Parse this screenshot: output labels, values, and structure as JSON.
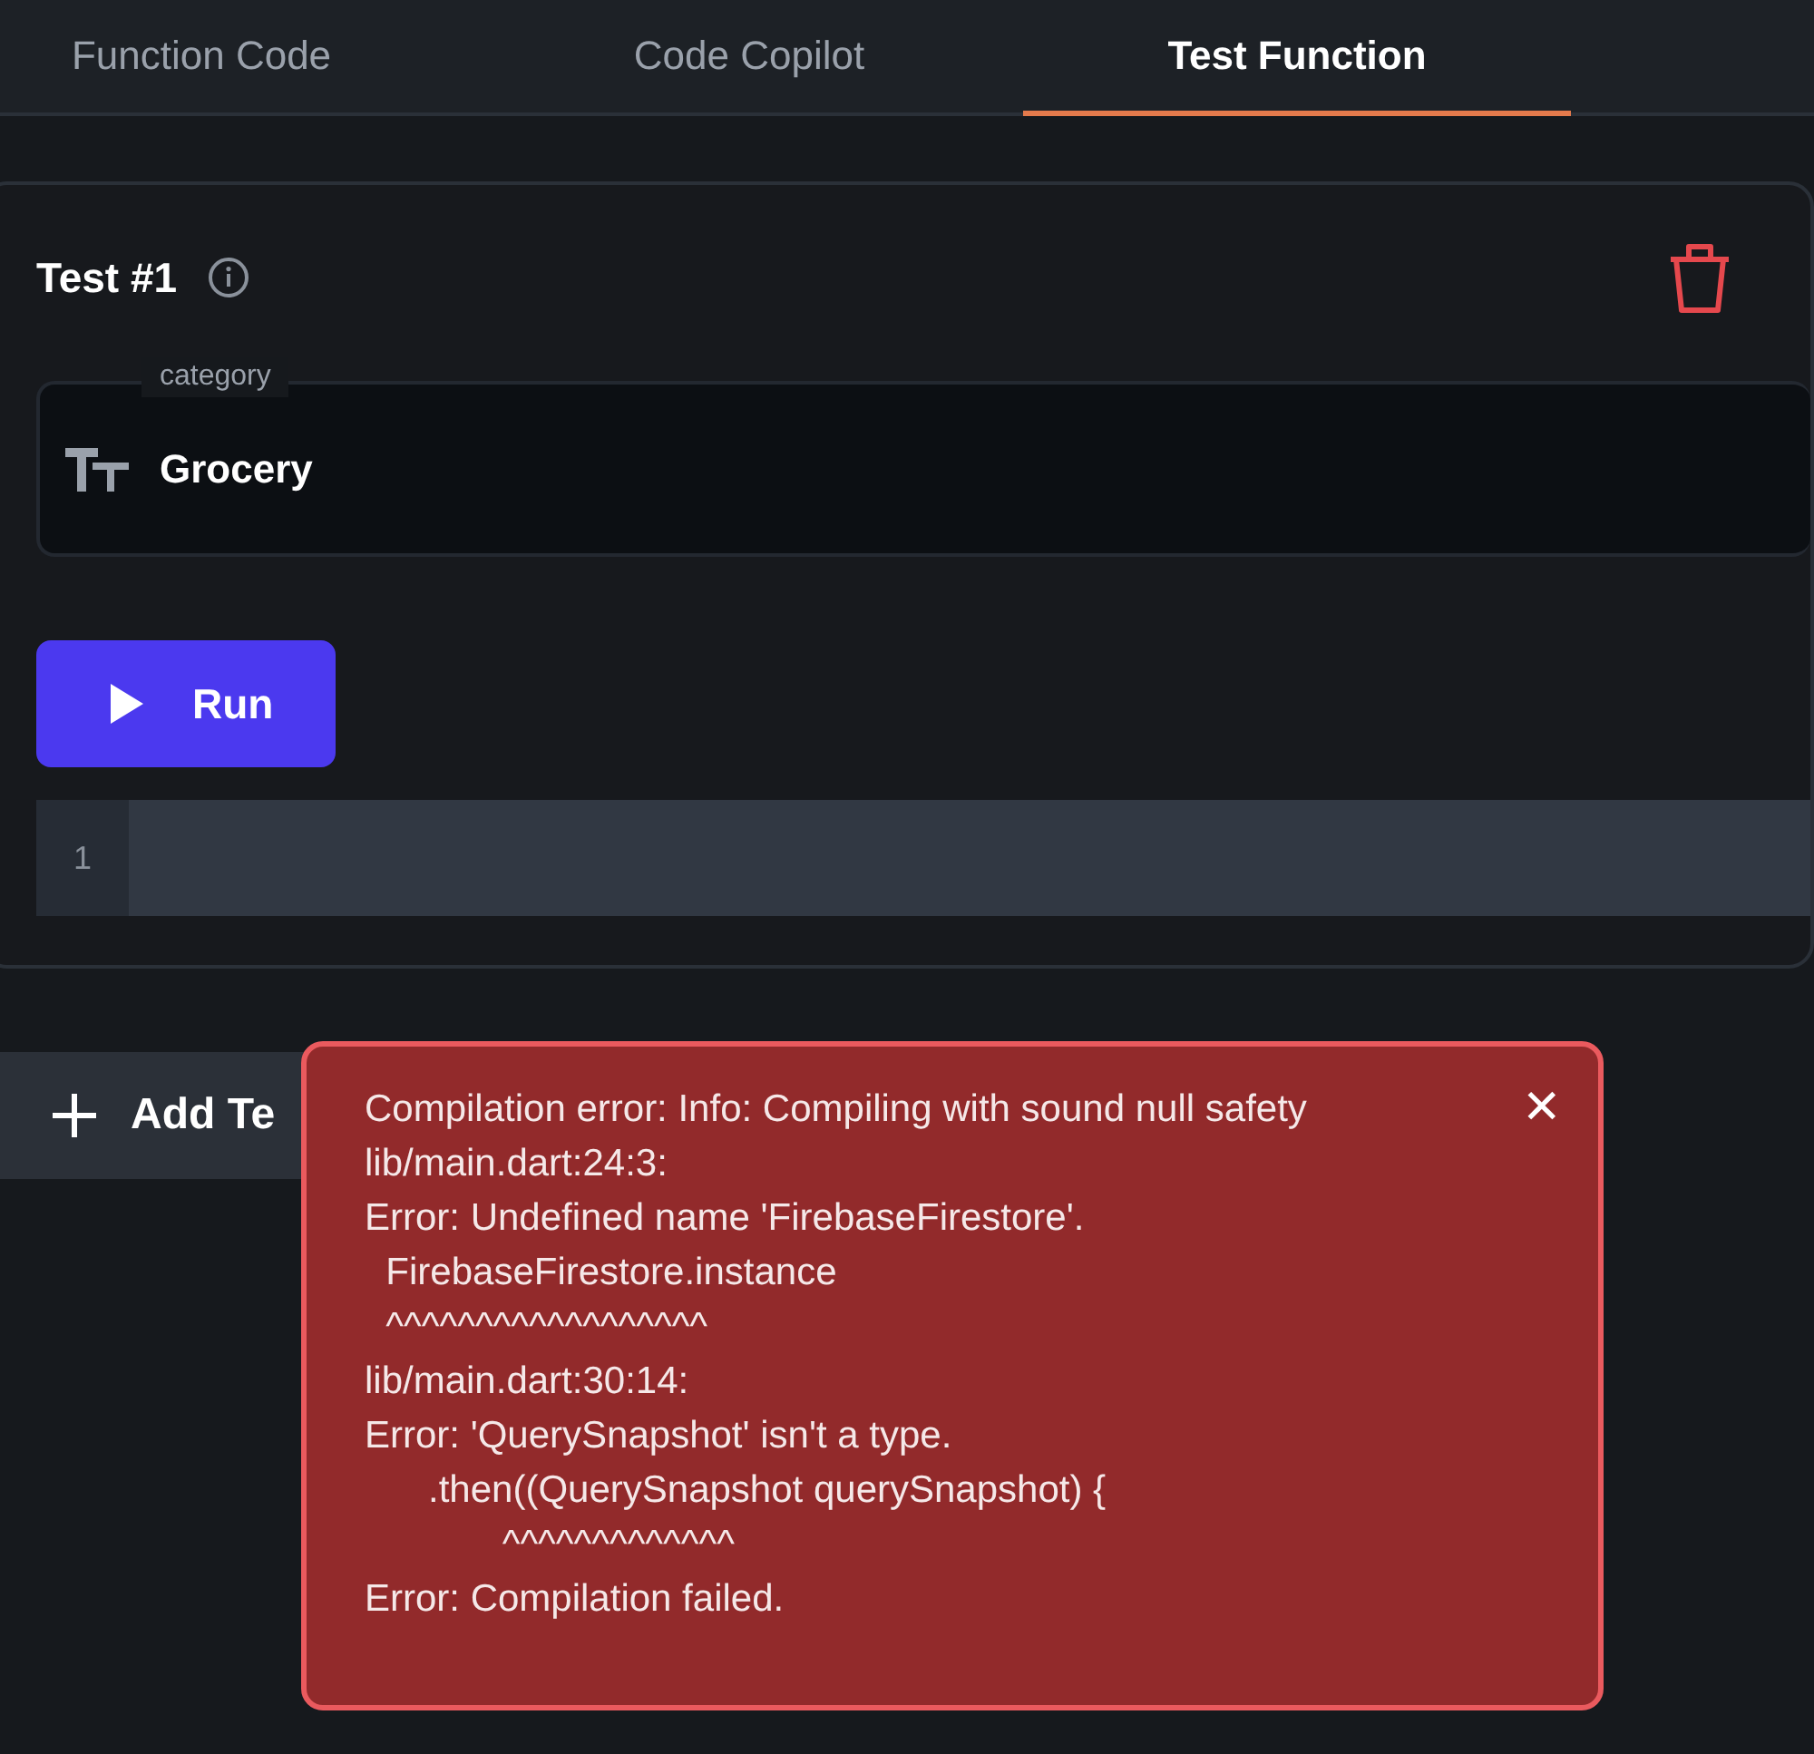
{
  "tabs": [
    {
      "label": "Function Code",
      "selected": false
    },
    {
      "label": "Code Copilot",
      "selected": false
    },
    {
      "label": "Test Function",
      "selected": true
    }
  ],
  "test": {
    "title": "Test #1",
    "field": {
      "label": "category",
      "value": "Grocery"
    },
    "run_button": "Run",
    "editor": {
      "line_numbers": [
        "1"
      ]
    }
  },
  "add_test_button": "Add Te",
  "toast": {
    "close": "✕",
    "lines": [
      "Compilation error: Info: Compiling with sound null safety",
      "lib/main.dart:24:3:",
      "Error: Undefined name 'FirebaseFirestore'.",
      "  FirebaseFirestore.instance",
      "  ^^^^^^^^^^^^^^^^^^",
      "lib/main.dart:30:14:",
      "Error: 'QuerySnapshot' isn't a type.",
      "      .then((QuerySnapshot querySnapshot) {",
      "             ^^^^^^^^^^^^^",
      "Error: Compilation failed."
    ]
  }
}
